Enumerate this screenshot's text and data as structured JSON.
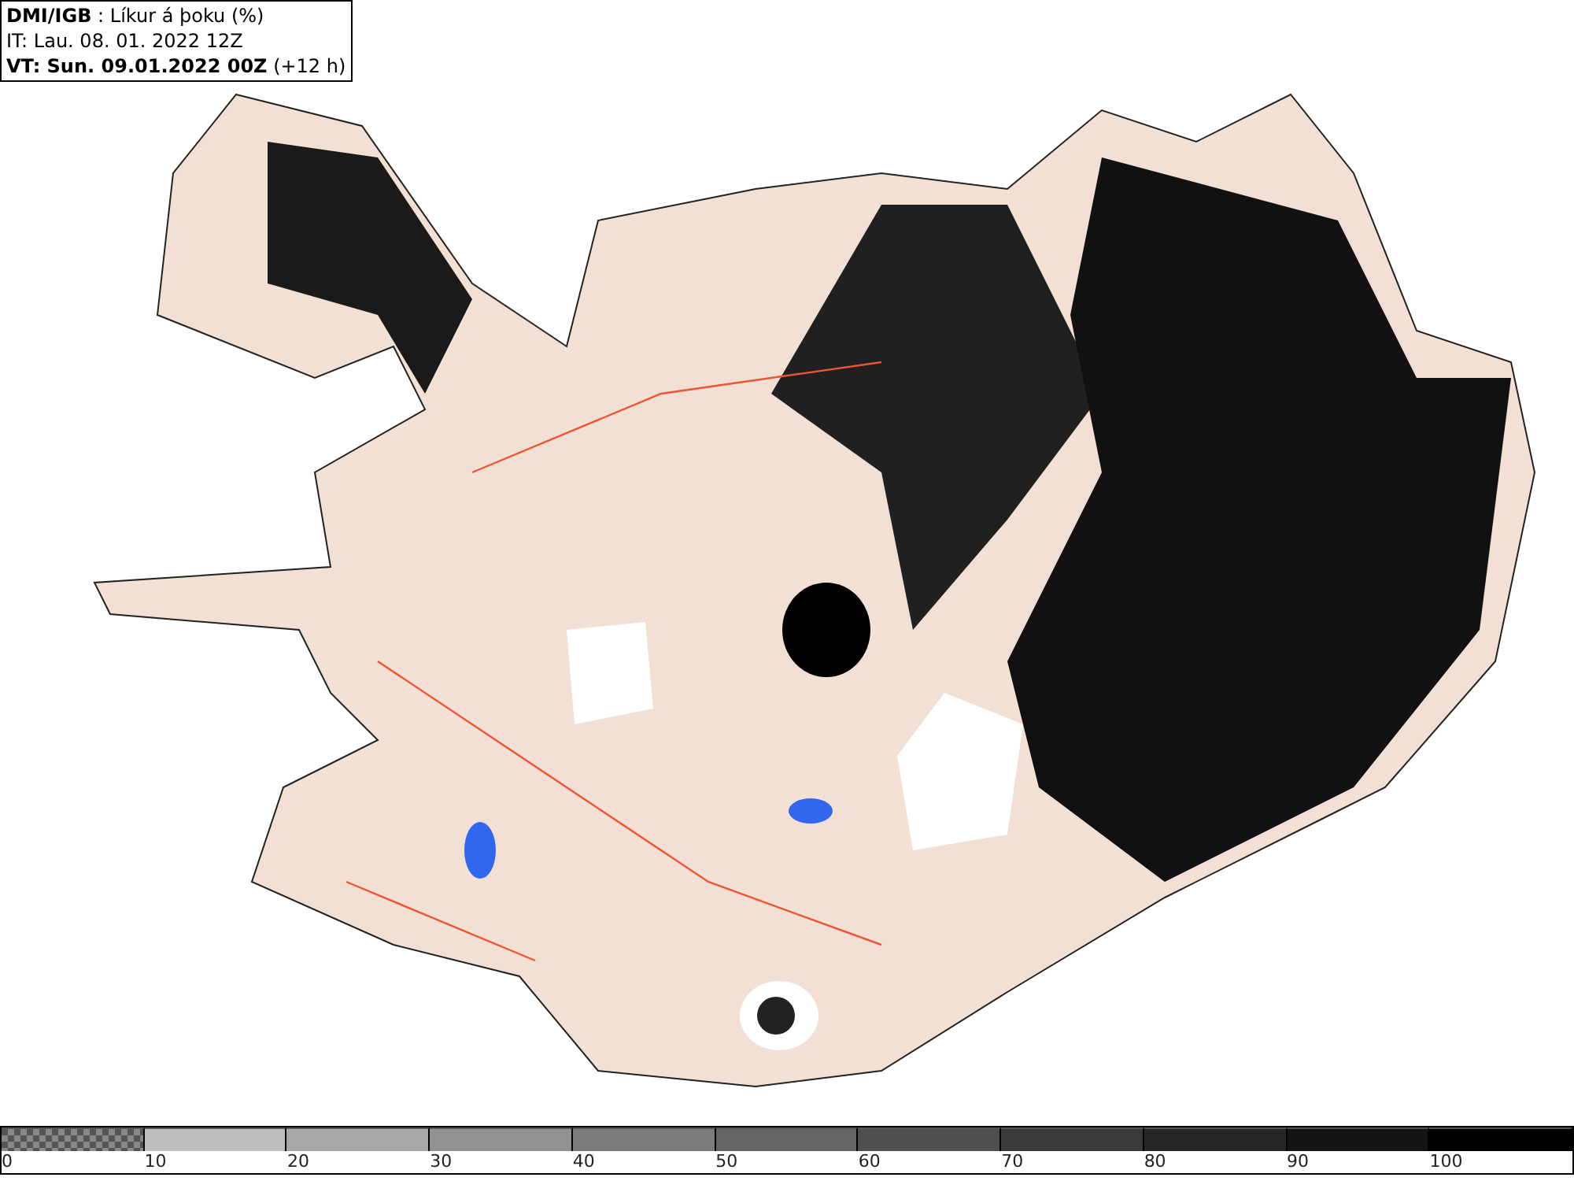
{
  "header": {
    "title": "**DMI/IGB** : Líkur á þoku (%)",
    "initial_time": "IT: Lau. 08. 01. 2022 12Z",
    "valid_time": "**VT: Sun. 09.01.2022 00Z** (+12 h)"
  },
  "legend": [
    {
      "label": "0",
      "kind": "checker",
      "color": "#555555"
    },
    {
      "label": "10",
      "kind": "solid",
      "color": "#bdbdbd"
    },
    {
      "label": "20",
      "kind": "solid",
      "color": "#a8a8a8"
    },
    {
      "label": "30",
      "kind": "solid",
      "color": "#929292"
    },
    {
      "label": "40",
      "kind": "solid",
      "color": "#7b7b7b"
    },
    {
      "label": "50",
      "kind": "solid",
      "color": "#656565"
    },
    {
      "label": "60",
      "kind": "solid",
      "color": "#4f4f4f"
    },
    {
      "label": "70",
      "kind": "solid",
      "color": "#3a3a3a"
    },
    {
      "label": "80",
      "kind": "solid",
      "color": "#262626"
    },
    {
      "label": "90",
      "kind": "solid",
      "color": "#141414"
    },
    {
      "label": "100",
      "kind": "solid",
      "color": "#000000"
    }
  ]
}
